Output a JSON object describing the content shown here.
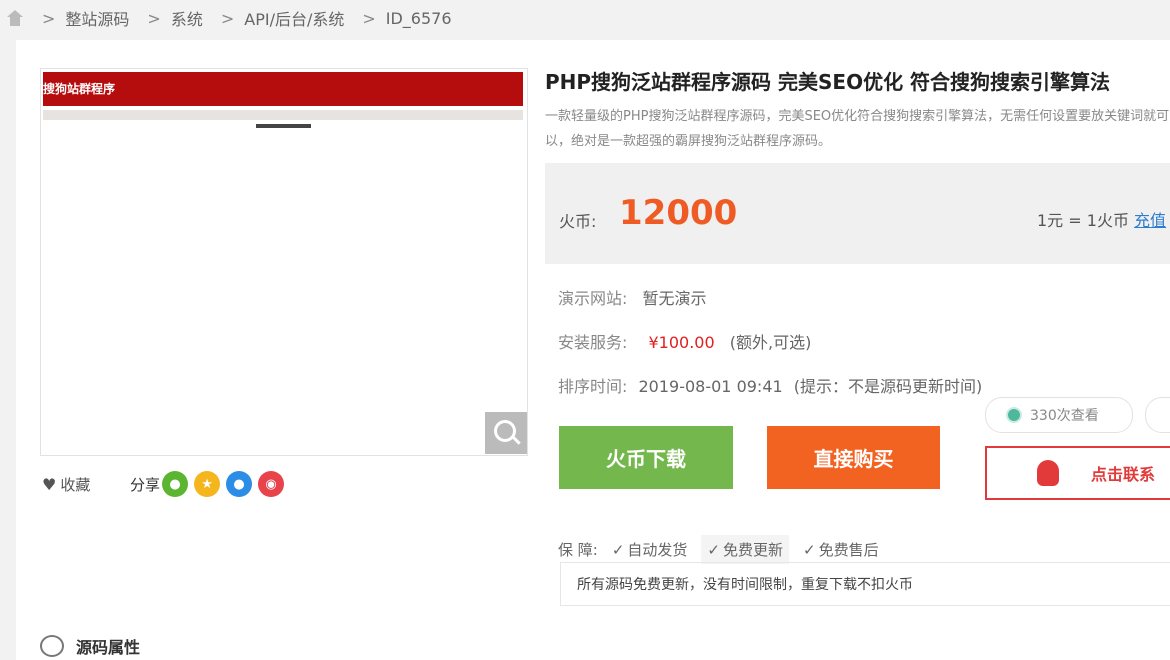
{
  "breadcrumb": {
    "home_icon": "home-icon",
    "items": [
      "整站源码",
      "系统",
      "API/后台/系统",
      "ID_6576"
    ],
    "separator": ">"
  },
  "preview": {
    "header_text": "搜狗站群程序",
    "zoom_icon": "magnifier-icon"
  },
  "actions": {
    "favorite_label": "收藏",
    "share_label": "分享",
    "share_icons": [
      "wechat-icon",
      "qzone-icon",
      "qq-icon",
      "weibo-icon"
    ]
  },
  "product": {
    "title": "PHP搜狗泛站群程序源码 完美SEO优化 符合搜狗搜索引擎算法",
    "description": "一款轻量级的PHP搜狗泛站群程序源码，完美SEO优化符合搜狗搜索引擎算法，无需任何设置要放关键词就可以，绝对是一款超强的霸屏搜狗泛站群程序源码。",
    "price_label": "火币:",
    "price_value": "12000",
    "rate_text": "1元 = 1火币",
    "rate_link": "充值",
    "demo_label": "演示网站:",
    "demo_value": "暂无演示",
    "install_label": "安装服务:",
    "install_price": "¥100.00",
    "install_note": "(额外,可选)",
    "sort_label": "排序时间:",
    "sort_value": "2019-08-01 09:41",
    "sort_note": "(提示：不是源码更新时间)"
  },
  "buttons": {
    "download": "火币下载",
    "buy": "直接购买",
    "views": "330次查看",
    "contact": "点击联系"
  },
  "guarantee": {
    "label": "保  障:",
    "items": [
      "自动发货",
      "免费更新",
      "免费售后"
    ],
    "note": "所有源码免费更新，没有时间限制，重复下载不扣火币"
  },
  "section": {
    "title": "源码属性"
  },
  "colors": {
    "price": "#ef5b24",
    "download_btn": "#73b74d",
    "buy_btn": "#f26322",
    "contact": "#e23a3a",
    "preview_header": "#b50d0d"
  }
}
